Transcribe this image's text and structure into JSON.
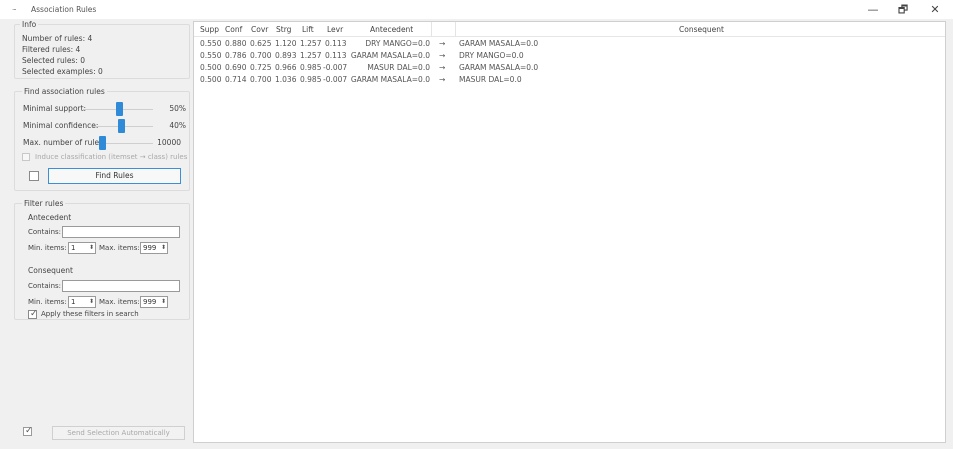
{
  "window": {
    "app_icon": "···",
    "title": "Association Rules",
    "minimize_symbol": "—",
    "maximize_symbol": "🗗",
    "close_symbol": "✕"
  },
  "info": {
    "title": "Info",
    "lines": [
      "Number of rules: 4",
      "Filtered rules: 4",
      "Selected rules: 0",
      "Selected examples: 0"
    ]
  },
  "find_rules": {
    "title": "Find association rules",
    "minimal_support_label": "Minimal support:",
    "minimal_support_value": "50%",
    "minimal_support_level": 0.5,
    "minimal_confidence_label": "Minimal confidence:",
    "minimal_confidence_value": "40%",
    "minimal_confidence_level": 0.4,
    "max_rules_label": "Max. number of rules:",
    "max_rules_value": "10000",
    "induce_classification_label": "Induce classification (itemset → class) rules",
    "find_button": "Find Rules"
  },
  "filter_rules": {
    "title": "Filter rules",
    "antecedent": {
      "title": "Antecedent",
      "contains_label": "Contains:",
      "contains_value": "",
      "min_items_label": "Min. items:",
      "min_items_value": "1",
      "max_items_label": "Max. items:",
      "max_items_value": "999"
    },
    "consequent": {
      "title": "Consequent",
      "contains_label": "Contains:",
      "contains_value": "",
      "min_items_label": "Min. items:",
      "min_items_value": "1",
      "max_items_label": "Max. items:",
      "max_items_value": "999"
    },
    "apply_filters_label": "Apply these filters in search"
  },
  "send_button": "Send Selection Automatically",
  "table": {
    "columns": [
      "Supp",
      "Conf",
      "Covr",
      "Strg",
      "Lift",
      "Levr",
      "Antecedent",
      "",
      "Consequent"
    ],
    "rows": [
      {
        "supp": "0.550",
        "conf": "0.880",
        "covr": "0.625",
        "strg": "1.120",
        "lift": "1.257",
        "levr": "0.113",
        "antecedent": "DRY MANGO=0.0",
        "arrow": "→",
        "consequent": "GARAM MASALA=0.0"
      },
      {
        "supp": "0.550",
        "conf": "0.786",
        "covr": "0.700",
        "strg": "0.893",
        "lift": "1.257",
        "levr": "0.113",
        "antecedent": "GARAM MASALA=0.0",
        "arrow": "→",
        "consequent": "DRY MANGO=0.0"
      },
      {
        "supp": "0.500",
        "conf": "0.690",
        "covr": "0.725",
        "strg": "0.966",
        "lift": "0.985",
        "levr": "-0.007",
        "antecedent": "MASUR DAL=0.0",
        "arrow": "→",
        "consequent": "GARAM MASALA=0.0"
      },
      {
        "supp": "0.500",
        "conf": "0.714",
        "covr": "0.700",
        "strg": "1.036",
        "lift": "0.985",
        "levr": "-0.007",
        "antecedent": "GARAM MASALA=0.0",
        "arrow": "→",
        "consequent": "MASUR DAL=0.0"
      }
    ]
  }
}
